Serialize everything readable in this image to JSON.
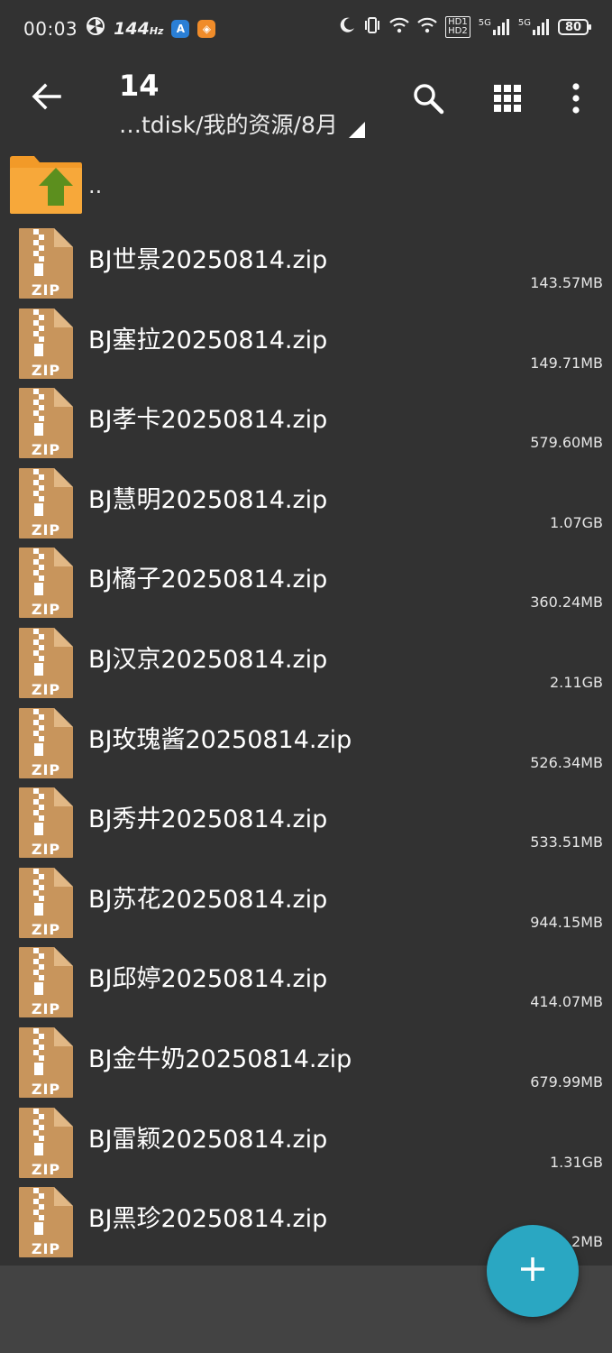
{
  "status_bar": {
    "time": "00:03",
    "refresh_rate": "144",
    "refresh_unit": "Hz",
    "hd1": "HD1",
    "hd2": "HD2",
    "net1": "5G",
    "net2": "5G",
    "battery": "80"
  },
  "toolbar": {
    "title": "14",
    "path": "…tdisk/我的资源/8月"
  },
  "list": {
    "parent_label": "..",
    "files": [
      {
        "name": "BJ世景20250814.zip",
        "size": "143.57MB"
      },
      {
        "name": "BJ塞拉20250814.zip",
        "size": "149.71MB"
      },
      {
        "name": "BJ孝卡20250814.zip",
        "size": "579.60MB"
      },
      {
        "name": "BJ慧明20250814.zip",
        "size": "1.07GB"
      },
      {
        "name": "BJ橘子20250814.zip",
        "size": "360.24MB"
      },
      {
        "name": "BJ汉京20250814.zip",
        "size": "2.11GB"
      },
      {
        "name": "BJ玫瑰酱20250814.zip",
        "size": "526.34MB"
      },
      {
        "name": "BJ秀井20250814.zip",
        "size": "533.51MB"
      },
      {
        "name": "BJ苏花20250814.zip",
        "size": "944.15MB"
      },
      {
        "name": "BJ邱婷20250814.zip",
        "size": "414.07MB"
      },
      {
        "name": "BJ金牛奶20250814.zip",
        "size": "679.99MB"
      },
      {
        "name": "BJ雷颖20250814.zip",
        "size": "1.31GB"
      },
      {
        "name": "BJ黑珍20250814.zip",
        "size": "2MB"
      }
    ],
    "zip_label": "ZIP"
  },
  "colors": {
    "background": "#323232",
    "fab": "#2aa7c2",
    "zip_icon": "#c8955c",
    "folder": "#f29a28",
    "up_arrow": "#5c8f1e"
  },
  "icons": {
    "back": "arrow-left-icon",
    "search": "search-icon",
    "grid": "grid-view-icon",
    "menu": "more-vertical-icon",
    "fab": "plus-icon"
  }
}
